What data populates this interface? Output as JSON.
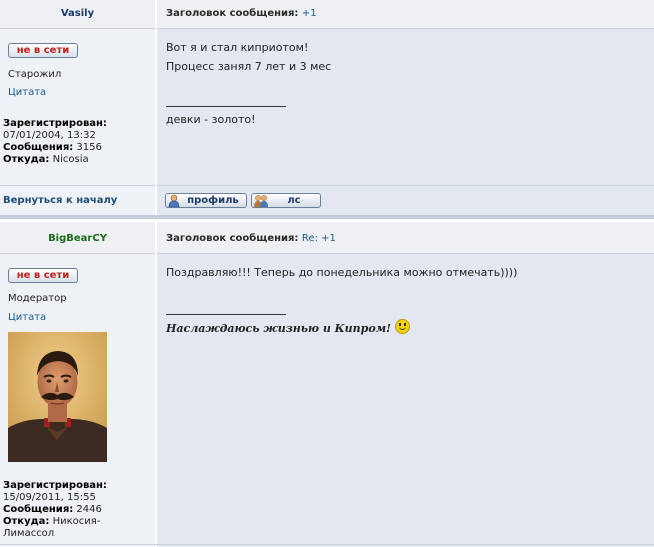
{
  "post1": {
    "username": "Vasily",
    "title_label": "Заголовок сообщения:",
    "title_value": "+1",
    "status_button": "не в сети",
    "rank": "Старожил",
    "quote": "Цитата",
    "registered_label": "Зарегистрирован:",
    "registered_value": "07/01/2004, 13:32",
    "posts_label": "Сообщения:",
    "posts_value": "3156",
    "from_label": "Откуда:",
    "from_value": "Nicosia",
    "message_line1": "Вот я и стал киприотом!",
    "message_line2": "Процесс занял 7 лет и 3 мес",
    "signature": "девки - золото!"
  },
  "footer": {
    "back_to_top": "Вернуться к началу",
    "profile_button": "профиль",
    "pm_button": "лс"
  },
  "post2": {
    "username": "BigBearCY",
    "title_label": "Заголовок сообщения:",
    "title_value": "Re: +1",
    "status_button": "не в сети",
    "rank": "Модератор",
    "quote": "Цитата",
    "registered_label": "Зарегистрирован:",
    "registered_value": "15/09/2011, 15:55",
    "posts_label": "Сообщения:",
    "posts_value": "2446",
    "from_label": "Откуда:",
    "from_value_line1": "Никосия-",
    "from_value_line2": "Лимассол",
    "message": "Поздравляю!!! Теперь до понедельника можно отмечать))))",
    "signature": "Наслаждаюсь жизнью и Кипром!"
  },
  "colors": {
    "link": "#1d5a8a",
    "offline": "#c0201a",
    "moderator": "#1a6a1a"
  }
}
